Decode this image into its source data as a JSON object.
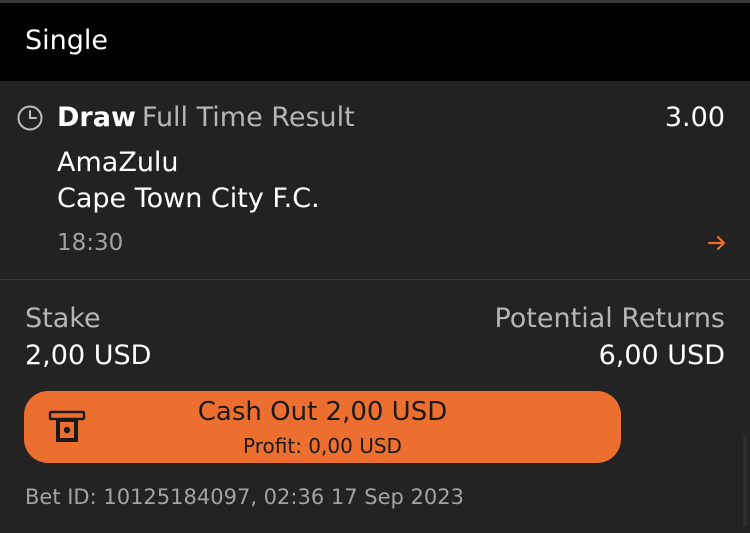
{
  "header": {
    "title": "Single"
  },
  "selection": {
    "name": "Draw",
    "market": "Full Time Result",
    "odds": "3.00",
    "team_home": "AmaZulu",
    "team_away": "Cape Town City F.C.",
    "time": "18:30"
  },
  "stake": {
    "label": "Stake",
    "value": "2,00 USD"
  },
  "returns": {
    "label": "Potential Returns",
    "value": "6,00 USD"
  },
  "cashout": {
    "label": "Cash Out 2,00 USD",
    "profit": "Profit: 0,00 USD"
  },
  "bet": {
    "info": "Bet ID: 10125184097, 02:36 17 Sep 2023"
  },
  "colors": {
    "accent": "#ec6f2f",
    "header_bg": "#000000",
    "body_bg": "#232323"
  },
  "icons": {
    "clock": "clock-icon",
    "arrow": "arrow-right-icon",
    "cashout": "cash-register-icon"
  }
}
